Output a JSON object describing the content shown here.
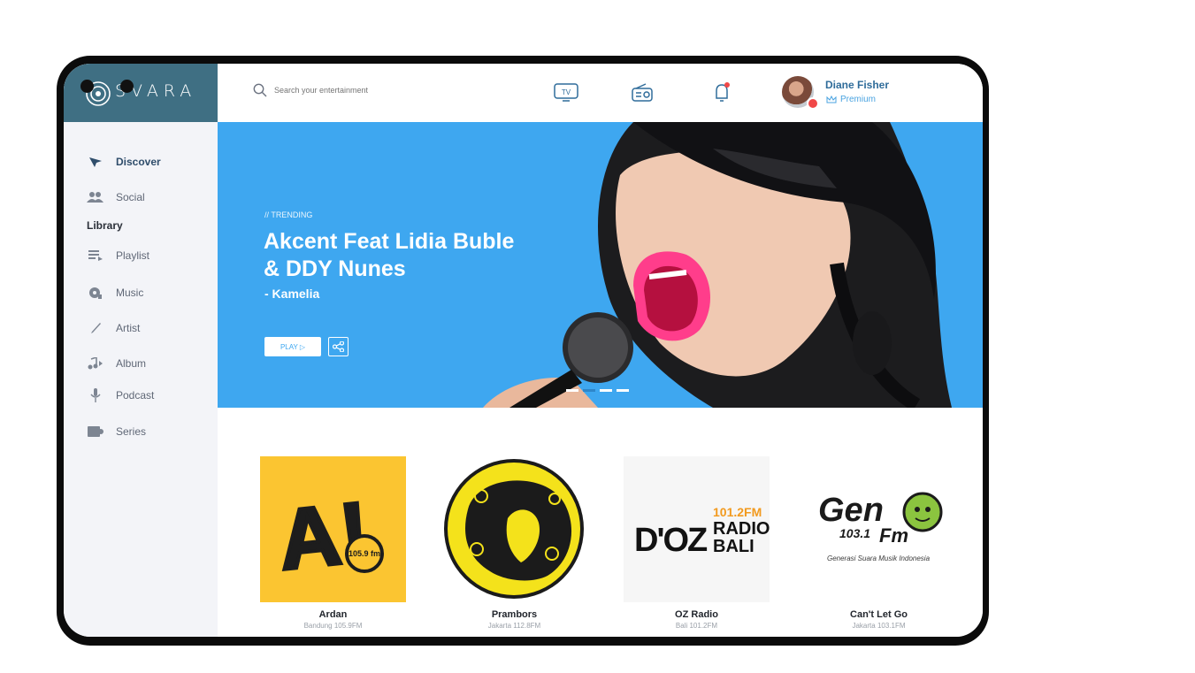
{
  "app": {
    "logo_text": "SVARA"
  },
  "colors": {
    "accent": "#3ea7f0",
    "sidebar_header": "#3f6f83",
    "active_nav": "#2f4d6b"
  },
  "search": {
    "placeholder": "Search your entertainment"
  },
  "header": {
    "icons": [
      "tv-icon",
      "radio-icon",
      "bell-icon"
    ],
    "tv_label": "TV",
    "user": {
      "name": "Diane Fisher",
      "tier": "Premium"
    }
  },
  "sidebar": {
    "items": [
      {
        "label": "Discover",
        "icon": "compass-icon",
        "active": true
      },
      {
        "label": "Social",
        "icon": "users-icon"
      }
    ],
    "library_label": "Library",
    "library_items": [
      {
        "label": "Playlist",
        "icon": "playlist-icon"
      },
      {
        "label": "Music",
        "icon": "music-icon"
      },
      {
        "label": "Artist",
        "icon": "brush-icon"
      },
      {
        "label": "Album",
        "icon": "album-icon"
      },
      {
        "label": "Podcast",
        "icon": "microphone-icon"
      },
      {
        "label": "Series",
        "icon": "series-icon"
      }
    ]
  },
  "hero": {
    "tag": "// TRENDING",
    "title": "Akcent Feat Lidia Buble & DDY Nunes",
    "subtitle": "- Kamelia",
    "play_label": "PLAY ▷",
    "carousel_dots": 4,
    "active_dot": 1
  },
  "stations": [
    {
      "name": "Ardan",
      "freq": "Bandung 105.9FM",
      "logo_text": "A!",
      "logo_sub": "105.9 fm"
    },
    {
      "name": "Prambors",
      "freq": "Jakarta 112.8FM"
    },
    {
      "name": "OZ Radio",
      "freq": "Bali 101.2FM",
      "logo_text": "D'OZ",
      "logo_sub": "101.2FM",
      "logo_sub2": "RADIO",
      "logo_sub3": "BALI"
    },
    {
      "name": "Can't Let Go",
      "freq": "Jakarta 103.1FM",
      "logo_text": "Gen",
      "logo_sub": "103.1",
      "logo_sub2": "Fm",
      "logo_tagline": "Generasi Suara Musik Indonesia"
    }
  ]
}
